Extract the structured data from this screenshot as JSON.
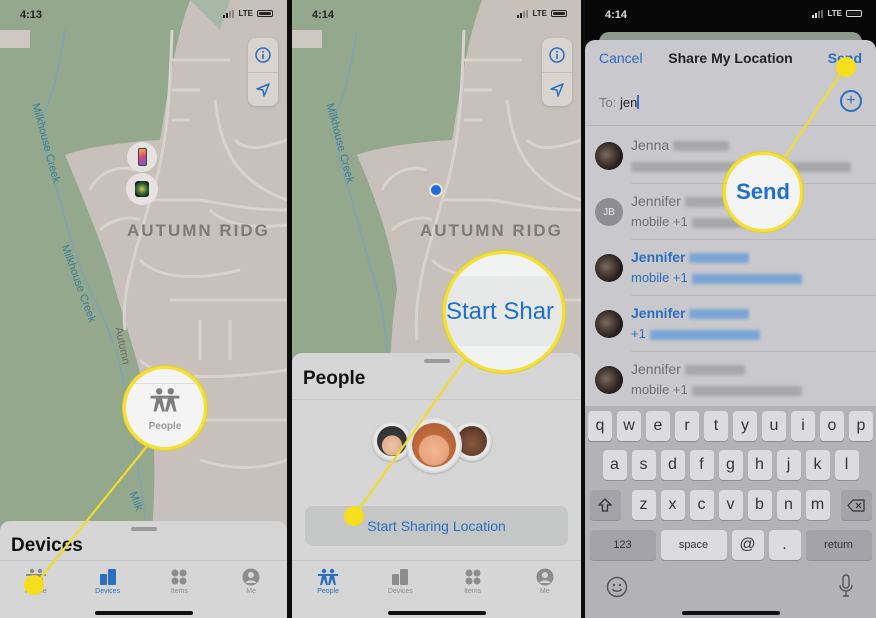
{
  "panel1": {
    "status": {
      "time": "4:13",
      "network": "LTE"
    },
    "map": {
      "area_label": "AUTUMN RIDG",
      "creek_label_upper": "Milkhouse Creek",
      "creek_label_lower": "Milkhouse Creek",
      "creek_label_bottom": "Milk",
      "road_label": "Autumn"
    },
    "sheet": {
      "title": "Devices"
    },
    "tabs": [
      {
        "label": "People",
        "icon": "people-icon",
        "active": false
      },
      {
        "label": "Devices",
        "icon": "devices-icon",
        "active": true
      },
      {
        "label": "Items",
        "icon": "items-icon",
        "active": false
      },
      {
        "label": "Me",
        "icon": "me-icon",
        "active": false
      }
    ],
    "callout": {
      "label": "People"
    }
  },
  "panel2": {
    "status": {
      "time": "4:14",
      "network": "LTE"
    },
    "map": {
      "area_label": "AUTUMN RIDG",
      "creek_label": "Milkhouse Creek"
    },
    "sheet": {
      "title": "People",
      "button_label": "Start Sharing Location"
    },
    "tabs": [
      {
        "label": "People",
        "icon": "people-icon",
        "active": true
      },
      {
        "label": "Devices",
        "icon": "devices-icon",
        "active": false
      },
      {
        "label": "Items",
        "icon": "items-icon",
        "active": false
      },
      {
        "label": "Me",
        "icon": "me-icon",
        "active": false
      }
    ],
    "callout": {
      "label": "Start Shar"
    }
  },
  "panel3": {
    "status": {
      "time": "4:14",
      "network": "LTE"
    },
    "nav": {
      "cancel": "Cancel",
      "title": "Share My Location",
      "send": "Send"
    },
    "to": {
      "label": "To:",
      "value": "jen"
    },
    "contacts": [
      {
        "name": "Jenna",
        "sub": "",
        "avatar": "photo",
        "highlighted": false
      },
      {
        "name": "Jennifer",
        "sub": "mobile +1",
        "avatar": "JB",
        "highlighted": false
      },
      {
        "name": "Jennifer",
        "sub": "mobile +1",
        "avatar": "photo",
        "highlighted": true
      },
      {
        "name": "Jennifer",
        "sub": "+1",
        "avatar": "photo",
        "highlighted": true
      },
      {
        "name": "Jennifer",
        "sub": "mobile +1",
        "avatar": "photo",
        "highlighted": false
      }
    ],
    "keyboard": {
      "row1": [
        "q",
        "w",
        "e",
        "r",
        "t",
        "y",
        "u",
        "i",
        "o",
        "p"
      ],
      "row2": [
        "a",
        "s",
        "d",
        "f",
        "g",
        "h",
        "j",
        "k",
        "l"
      ],
      "row3": [
        "z",
        "x",
        "c",
        "v",
        "b",
        "n",
        "m"
      ],
      "numbers": "123",
      "space": "space",
      "at": "@",
      "dot": ".",
      "return": "return"
    },
    "callout": {
      "label": "Send"
    }
  },
  "colors": {
    "accent": "#2a6fc2",
    "highlight": "#f4e03a",
    "park": "#93a88c",
    "land": "#c7c0bb"
  }
}
